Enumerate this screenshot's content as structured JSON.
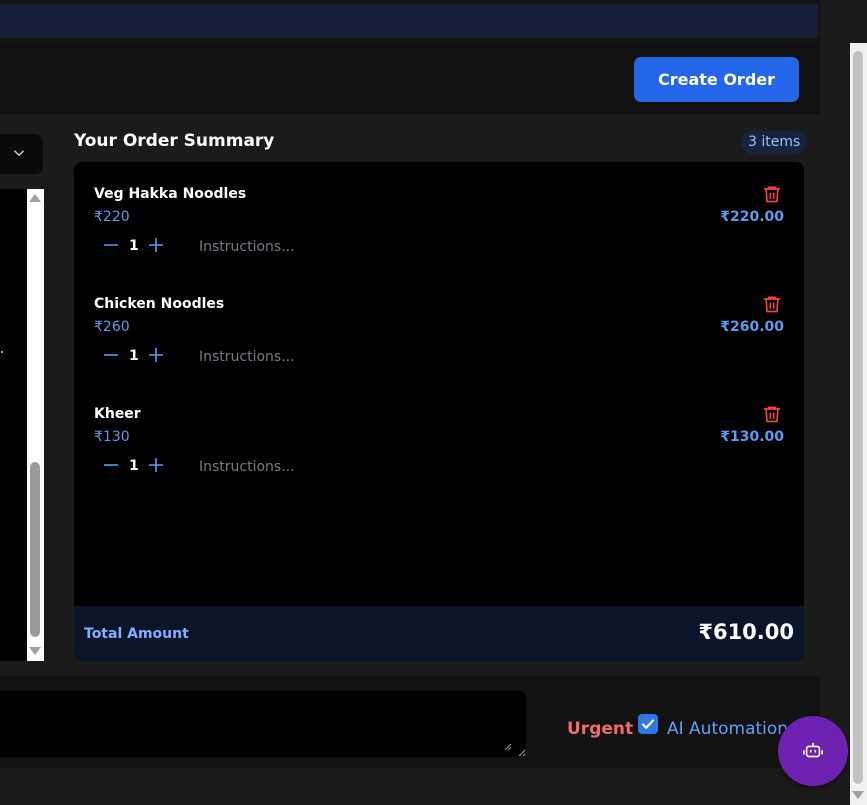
{
  "header": {
    "create_order_label": "Create Order"
  },
  "summary": {
    "title": "Your Order Summary",
    "items_count": "3 items",
    "instructions_placeholder": "Instructions...",
    "items": [
      {
        "name": "Veg Hakka Noodles",
        "price": "₹220",
        "qty": "1",
        "line_total": "₹220.00"
      },
      {
        "name": "Chicken Noodles",
        "price": "₹260",
        "qty": "1",
        "line_total": "₹260.00"
      },
      {
        "name": "Kheer",
        "price": "₹130",
        "qty": "1",
        "line_total": "₹130.00"
      }
    ],
    "total_label": "Total Amount",
    "total_amount": "₹610.00"
  },
  "footer": {
    "urgent_label": "Urgent",
    "ai_automation_label": "AI Automation",
    "ai_automation_checked": true
  },
  "icons": {
    "delete": "trash-icon",
    "decrease": "minus-icon",
    "increase": "plus-icon",
    "dropdown": "chevron-down-icon",
    "assistant": "robot-icon"
  },
  "colors": {
    "accent": "#2466e8",
    "price": "#5b9bf0",
    "danger": "#ef4444",
    "assistant": "#6d21b1"
  }
}
